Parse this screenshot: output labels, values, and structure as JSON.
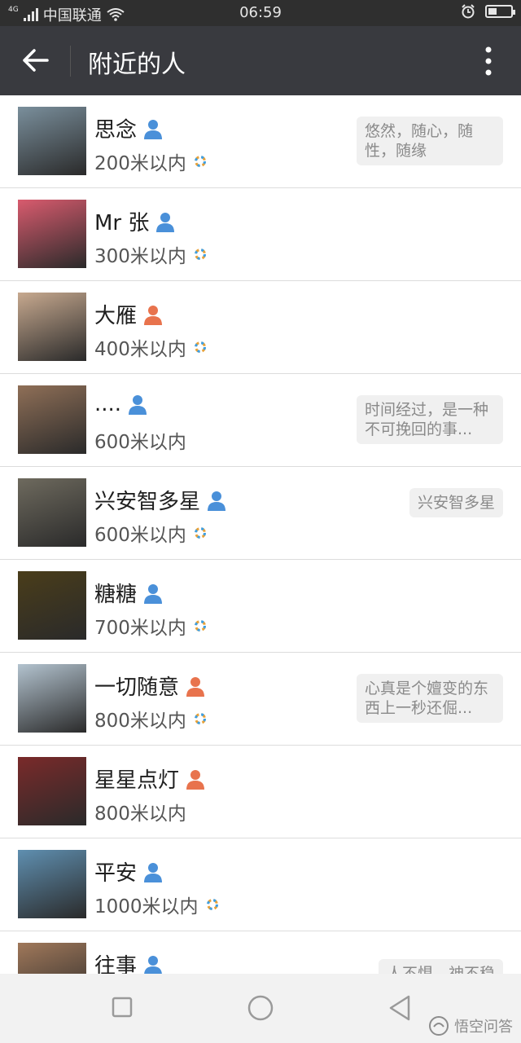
{
  "status_bar": {
    "network": "4G",
    "carrier": "中国联通",
    "time": "06:59"
  },
  "toolbar": {
    "title": "附近的人"
  },
  "rows": [
    {
      "name": "思念",
      "gender": "male",
      "distance": "200米以内",
      "signature": "悠然，随心，随性，随缘",
      "avatar_color": "#7a8f9c",
      "has_moment": true
    },
    {
      "name": "Mr 张",
      "gender": "male",
      "distance": "300米以内",
      "signature": "",
      "avatar_color": "#d95b6e",
      "has_moment": true
    },
    {
      "name": "大雁",
      "gender": "female",
      "distance": "400米以内",
      "signature": "",
      "avatar_color": "#c7a98f",
      "has_moment": true
    },
    {
      "name": "....",
      "gender": "male",
      "distance": "600米以内",
      "signature": "时间经过，是一种不可挽回的事...",
      "avatar_color": "#8f6f57",
      "has_moment": false
    },
    {
      "name": "兴安智多星",
      "gender": "male",
      "distance": "600米以内",
      "signature": "兴安智多星",
      "avatar_color": "#6e6a5e",
      "has_moment": true
    },
    {
      "name": "糖糖",
      "gender": "male",
      "distance": "700米以内",
      "signature": "",
      "avatar_color": "#4a3d1a",
      "has_moment": true
    },
    {
      "name": "一切随意",
      "gender": "female",
      "distance": "800米以内",
      "signature": "心真是个嬗变的东西上一秒还倔...",
      "avatar_color": "#b3c3cf",
      "has_moment": true
    },
    {
      "name": "星星点灯",
      "gender": "female",
      "distance": "800米以内",
      "signature": "",
      "avatar_color": "#7a2a2a",
      "has_moment": false
    },
    {
      "name": "平安",
      "gender": "male",
      "distance": "1000米以内",
      "signature": "",
      "avatar_color": "#5f8fb0",
      "has_moment": true
    },
    {
      "name": "往事",
      "gender": "male",
      "distance": "",
      "signature": "人不惧，神不稳",
      "avatar_color": "#a0785a",
      "has_moment": false
    }
  ],
  "watermark": "悟空问答",
  "colors": {
    "toolbar_bg": "#393a3f",
    "statusbar_bg": "#2f2f2f",
    "male_icon": "#4a90d9",
    "female_icon": "#e8734d"
  }
}
